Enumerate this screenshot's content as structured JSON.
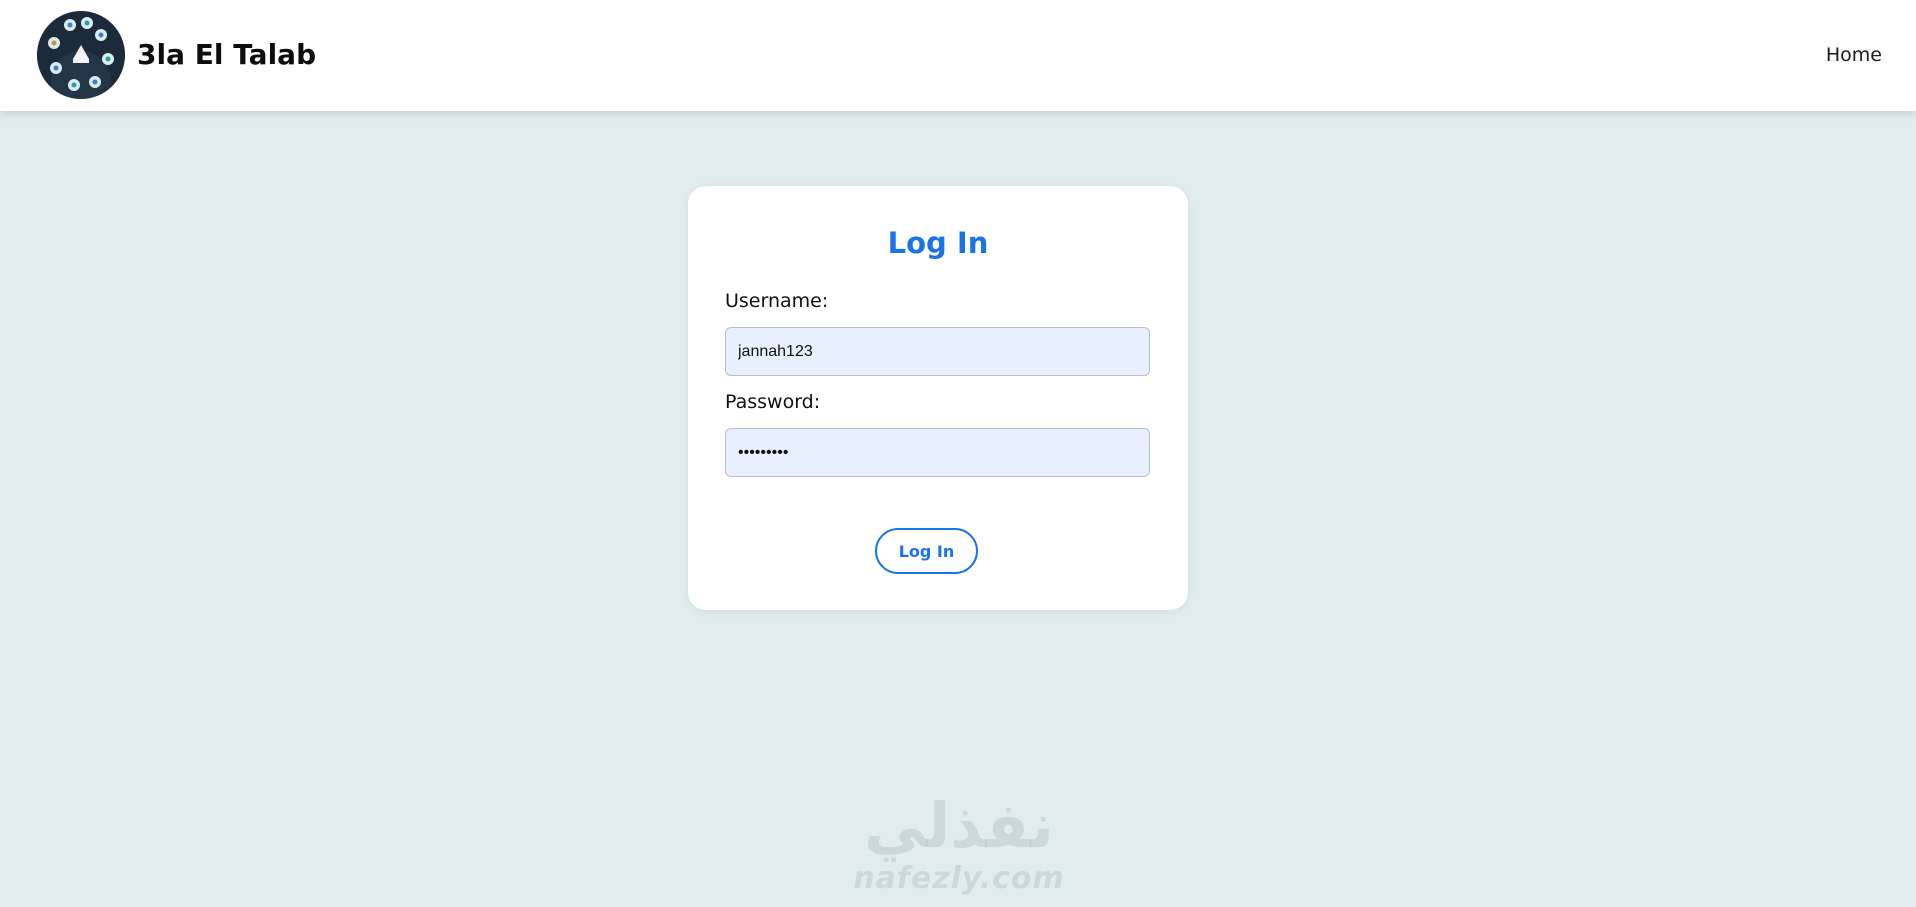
{
  "header": {
    "logo_icon": "site-logo-icon",
    "brand": "3la El Talab",
    "nav": {
      "home_label": "Home"
    }
  },
  "login": {
    "title": "Log In",
    "username_label": "Username:",
    "username_value": "jannah123",
    "password_label": "Password:",
    "password_value": "•••••••••",
    "submit_label": "Log In"
  },
  "watermark": {
    "arabic": "نفذلي",
    "latin": "nafezly.com"
  },
  "colors": {
    "accent": "#1a73e8",
    "page_background": "#e1eded",
    "input_background": "#e8f0fe"
  }
}
